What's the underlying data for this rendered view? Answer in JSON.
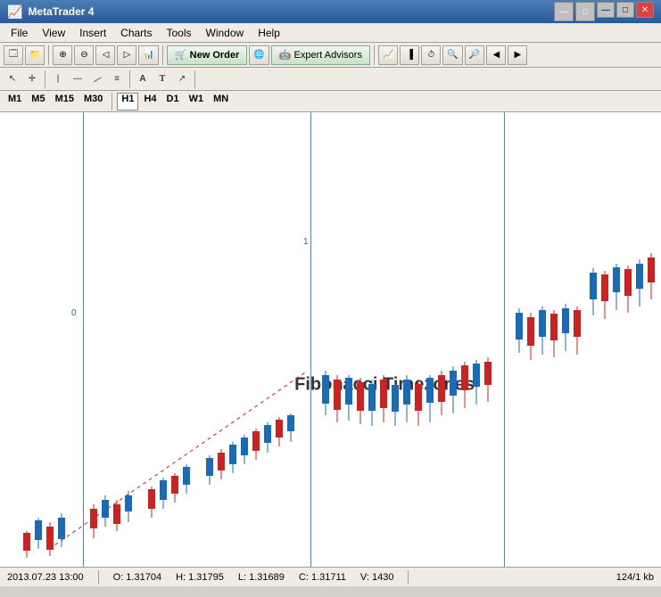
{
  "titlebar": {
    "text": "MetaTrader 4",
    "icon": "📈",
    "minimize": "—",
    "maximize": "□",
    "close": "✕",
    "inner_min": "—",
    "inner_max": "□",
    "inner_close": "✕"
  },
  "menubar": {
    "items": [
      "File",
      "View",
      "Insert",
      "Charts",
      "Tools",
      "Window",
      "Help"
    ]
  },
  "toolbar": {
    "new_order": "New Order",
    "expert_advisors": "Expert Advisors"
  },
  "timeframes": {
    "items": [
      "M1",
      "M5",
      "M15",
      "M30",
      "H1",
      "H4",
      "D1",
      "W1",
      "MN"
    ],
    "active": "H1"
  },
  "chart": {
    "fib_label": "Fibonacci Timezones",
    "line0_label": "0",
    "line1_label": "1"
  },
  "statusbar": {
    "datetime": "2013.07.23 13:00",
    "open": "O: 1.31704",
    "high": "H: 1.31795",
    "low": "L: 1.31689",
    "close": "C: 1.31711",
    "volume": "V: 1430",
    "info": "124/1 kb"
  }
}
